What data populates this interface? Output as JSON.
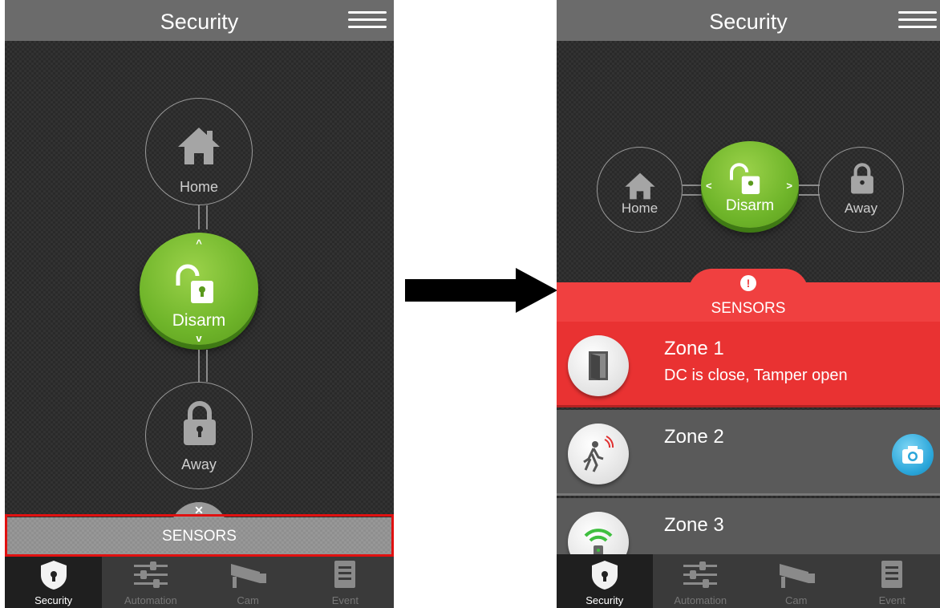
{
  "left": {
    "title": "Security",
    "nodes": {
      "home": "Home",
      "disarm": "Disarm",
      "away": "Away"
    },
    "sensors_bar": "SENSORS",
    "nav": [
      {
        "label": "Security",
        "icon": "shield-icon"
      },
      {
        "label": "Automation",
        "icon": "sliders-icon"
      },
      {
        "label": "Cam",
        "icon": "camera-icon"
      },
      {
        "label": "Event",
        "icon": "list-icon"
      }
    ]
  },
  "right": {
    "title": "Security",
    "nodes": {
      "home": "Home",
      "disarm": "Disarm",
      "away": "Away"
    },
    "sensors_header": "SENSORS",
    "zones": [
      {
        "name": "Zone 1",
        "status": "DC is close, Tamper open",
        "icon": "door-icon"
      },
      {
        "name": "Zone 2",
        "status": "",
        "icon": "motion-sensor-icon"
      },
      {
        "name": "Zone 3",
        "status": "",
        "icon": "wifi-sensor-icon"
      }
    ],
    "nav": [
      {
        "label": "Security",
        "icon": "shield-icon"
      },
      {
        "label": "Automation",
        "icon": "sliders-icon"
      },
      {
        "label": "Cam",
        "icon": "camera-icon"
      },
      {
        "label": "Event",
        "icon": "list-icon"
      }
    ]
  },
  "colors": {
    "accent_green": "#6fb52a",
    "alert_red": "#e93232",
    "highlight": "#e01010"
  }
}
